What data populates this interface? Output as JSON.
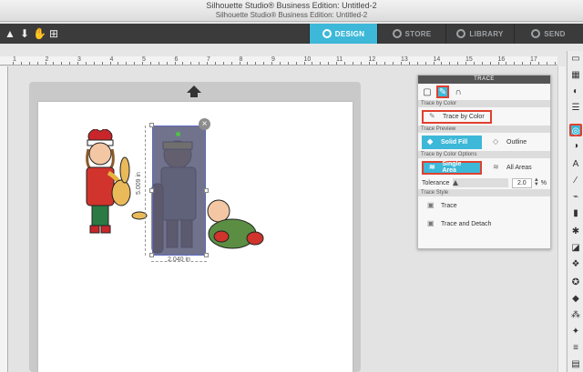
{
  "window": {
    "title": "Silhouette Studio® Business Edition: Untitled-2",
    "subtitle": "Silhouette Studio® Business Edition: Untitled-2"
  },
  "toolbar": {
    "tabs": [
      {
        "label": "DESIGN",
        "icon": "design-icon",
        "active": true
      },
      {
        "label": "STORE",
        "icon": "store-icon",
        "active": false
      },
      {
        "label": "LIBRARY",
        "icon": "library-icon",
        "active": false
      },
      {
        "label": "SEND",
        "icon": "send-icon",
        "active": false
      }
    ]
  },
  "ruler": {
    "numbers": [
      "1",
      "2",
      "3",
      "4",
      "5",
      "6",
      "7",
      "8",
      "9",
      "10",
      "11",
      "12",
      "13",
      "14",
      "15",
      "16",
      "17"
    ]
  },
  "selection": {
    "width_label": "2.040 in",
    "height_label": "5.009 in"
  },
  "trace_panel": {
    "header": "TRACE",
    "sections": {
      "trace_by_color": "Trace by Color",
      "trace_preview": "Trace Preview",
      "options": "Trace by Color Options",
      "style": "Trace Style"
    },
    "trace_by_color_button": "Trace by Color",
    "preview": {
      "solid_fill": "Solid Fill",
      "outline": "Outline"
    },
    "areas": {
      "single": "Single Area",
      "all": "All Areas"
    },
    "tolerance": {
      "label": "Tolerance",
      "value": "2.0",
      "unit": "%"
    },
    "style": {
      "trace": "Trace",
      "trace_detach": "Trace and Detach"
    }
  },
  "colors": {
    "accent": "#3db8d8",
    "highlight": "#e0402e",
    "toolbar": "#3b3b3b"
  }
}
